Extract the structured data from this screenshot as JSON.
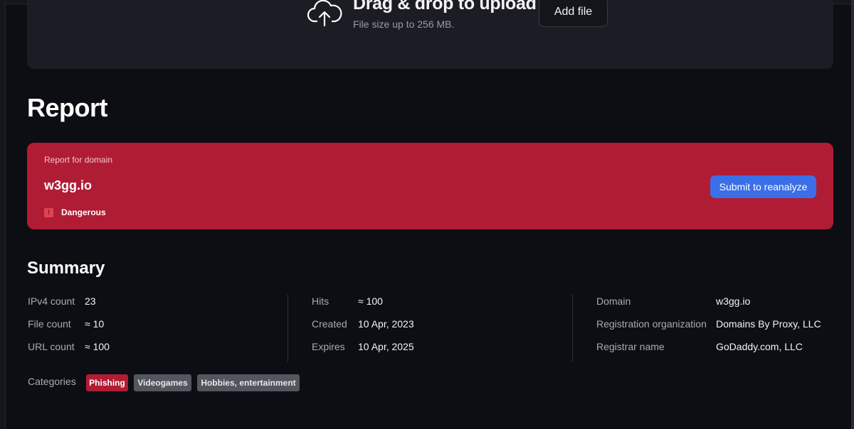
{
  "upload": {
    "title": "Drag & drop to upload",
    "subtitle": "File size up to 256 MB.",
    "add_file_label": "Add file",
    "icon": "cloud-upload-icon"
  },
  "report": {
    "heading": "Report",
    "card": {
      "caption": "Report for domain",
      "domain": "w3gg.io",
      "status": "Dangerous",
      "status_icon": "exclamation-icon",
      "button_label": "Submit to reanalyze",
      "color": "#b01c34"
    }
  },
  "summary": {
    "heading": "Summary",
    "col1": [
      {
        "label": "IPv4 count",
        "value": "23"
      },
      {
        "label": "File count",
        "value": "≈ 10"
      },
      {
        "label": "URL count",
        "value": "≈ 100"
      }
    ],
    "col2": [
      {
        "label": "Hits",
        "value": "≈ 100"
      },
      {
        "label": "Created",
        "value": "10 Apr, 2023"
      },
      {
        "label": "Expires",
        "value": "10 Apr, 2025"
      }
    ],
    "col3": [
      {
        "label": "Domain",
        "value": "w3gg.io"
      },
      {
        "label": "Registration organization",
        "value": "Domains By Proxy, LLC"
      },
      {
        "label": "Registrar name",
        "value": "GoDaddy.com, LLC"
      }
    ],
    "categories_label": "Categories",
    "categories": [
      "Phishing",
      "Videogames",
      "Hobbies, entertainment"
    ]
  },
  "colors": {
    "background": "#0d0e13",
    "panel": "#1b1c24",
    "danger": "#b01c34",
    "accent": "#3b6fe8"
  }
}
